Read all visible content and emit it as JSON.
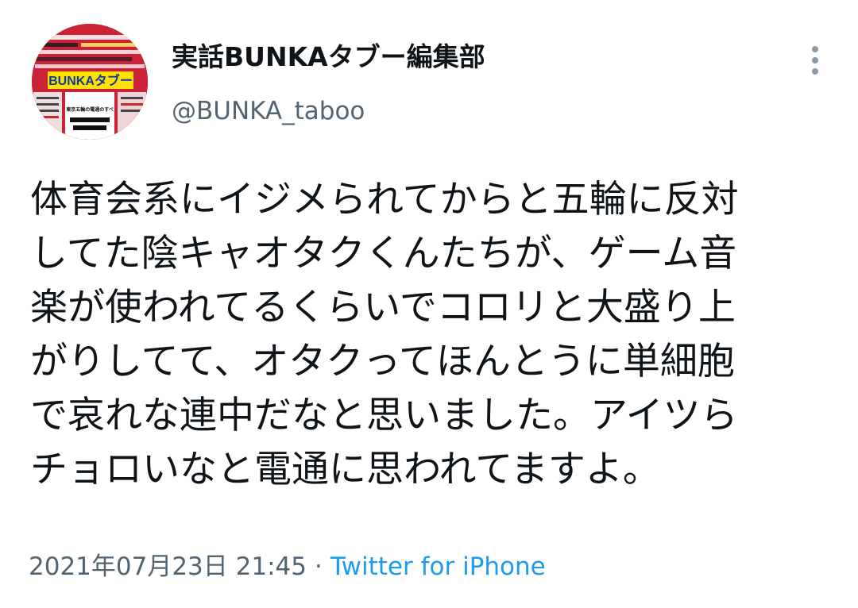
{
  "author": {
    "display_name": "実話BUNKAタブー編集部",
    "handle": "@BUNKA_taboo",
    "avatar_cover_title": "BUNKAタブー",
    "avatar_headline": "東京五輪の電通のすべ"
  },
  "tweet": {
    "lines": [
      "体育会系にイジメられてからと五輪に反対",
      "してた陰キャオタクくんたちが、ゲーム音",
      "楽が使われてるくらいでコロリと大盛り上",
      "がりしてて、オタクってほんとうに単細胞",
      "で哀れな連中だなと思いました。アイツら",
      "チョロいなと電通に思われてますよ。"
    ]
  },
  "meta": {
    "timestamp": "2021年07月23日 21:45",
    "separator": "·",
    "source": "Twitter for iPhone"
  },
  "icons": {
    "more": "more-vertical-icon"
  },
  "colors": {
    "text": "#0f1419",
    "secondary": "#536471",
    "link": "#1d9bf0",
    "avatar_red": "#c62a2a"
  }
}
